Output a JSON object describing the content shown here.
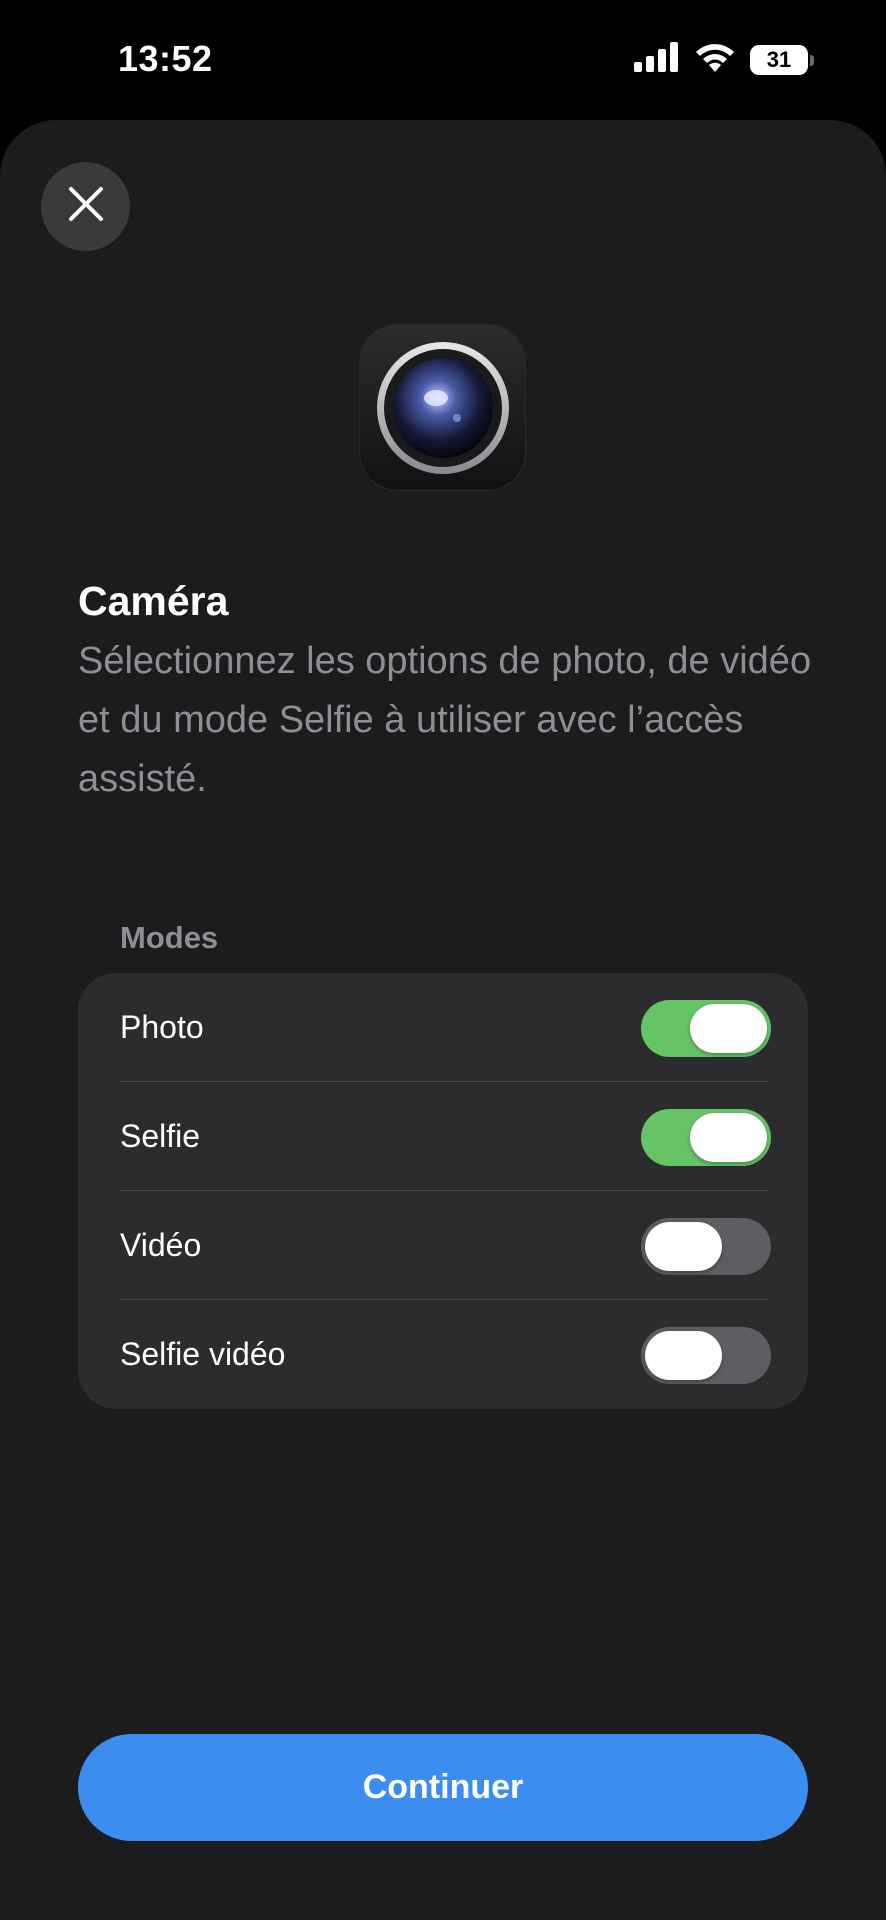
{
  "status_bar": {
    "time": "13:52",
    "battery": "31",
    "signal_icon": "cellular-signal-icon",
    "wifi_icon": "wifi-icon"
  },
  "header": {
    "close_icon": "close-icon",
    "app_icon": "camera-app-icon"
  },
  "main": {
    "title": "Caméra",
    "description": "Sélectionnez les options de photo, de vidéo et du mode Selfie à utiliser avec l’accès assisté."
  },
  "modes": {
    "header": "Modes",
    "items": [
      {
        "label": "Photo",
        "enabled": true
      },
      {
        "label": "Selfie",
        "enabled": true
      },
      {
        "label": "Vidéo",
        "enabled": false
      },
      {
        "label": "Selfie vidéo",
        "enabled": false
      }
    ]
  },
  "footer": {
    "continue_label": "Continuer"
  },
  "colors": {
    "accent": "#3b8ef0",
    "toggle_on": "#65c466",
    "toggle_off": "#5e5e62",
    "sheet_background": "#1c1c1e",
    "card_background": "#2c2c2e"
  }
}
